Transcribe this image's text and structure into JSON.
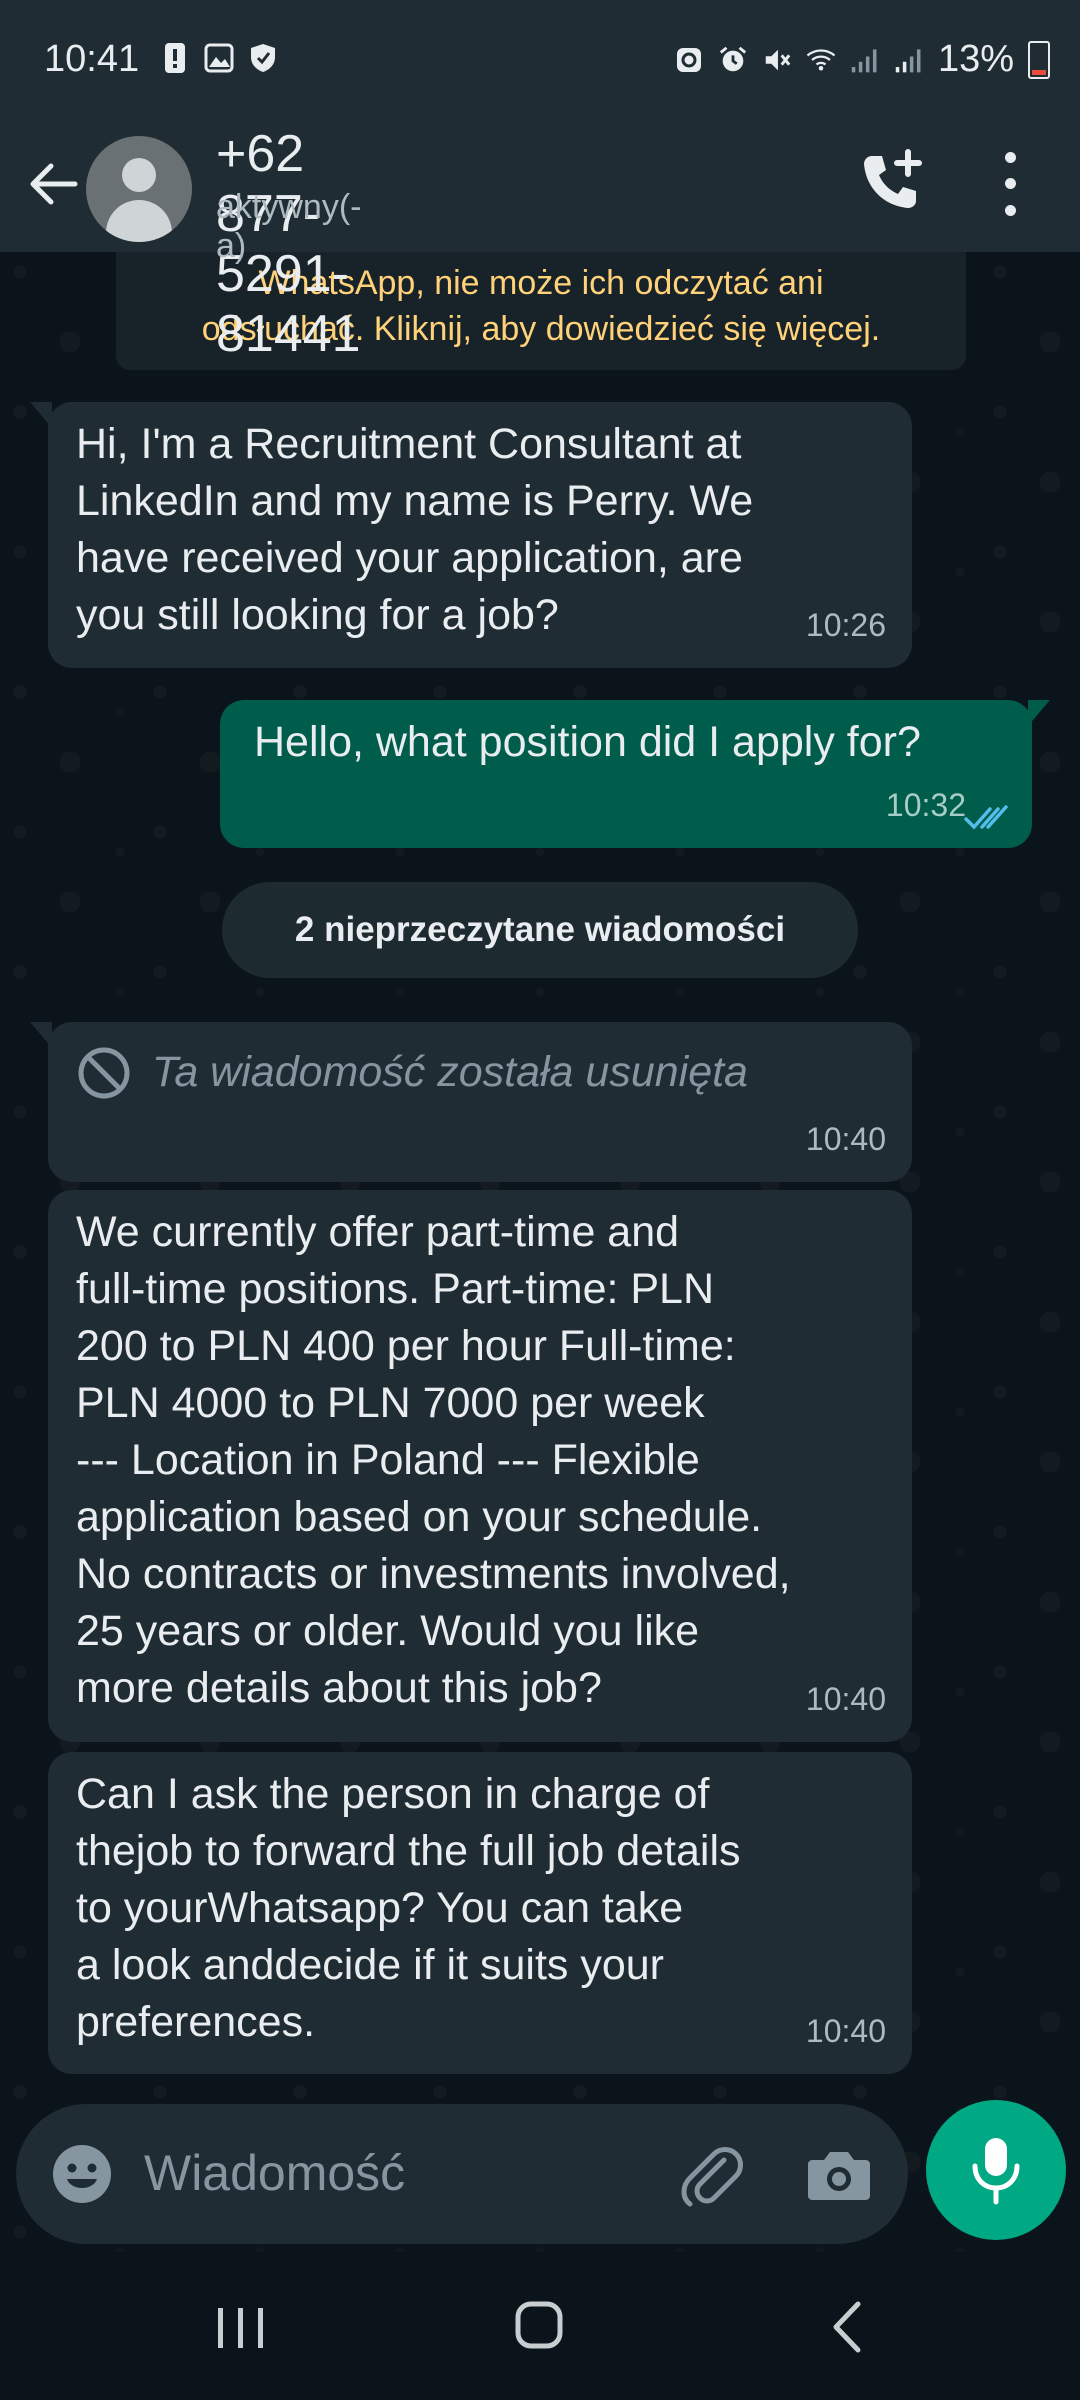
{
  "status_bar": {
    "time": "10:41",
    "battery": "13%"
  },
  "header": {
    "contact_name": "+62 877-5291-81441",
    "contact_status": "aktywny(-a)"
  },
  "encryption_notice": {
    "line1": "WhatsApp, nie może ich odczytać ani",
    "line2": "odsłuchać. Kliknij, aby dowiedzieć się więcej."
  },
  "messages": [
    {
      "direction": "incoming",
      "lines": [
        "Hi, I'm a Recruitment Consultant at",
        "LinkedIn and my name is Perry. We",
        "have received your application, are",
        "you still looking for a job?"
      ],
      "time": "10:26"
    },
    {
      "direction": "outgoing",
      "lines": [
        "Hello, what position did I apply for?"
      ],
      "time": "10:32",
      "status": "read"
    },
    {
      "direction": "incoming",
      "deleted": true,
      "lines": [
        "Ta wiadomość została usunięta"
      ],
      "time": "10:40"
    },
    {
      "direction": "incoming",
      "lines": [
        "We currently offer part-time and",
        "full-time positions. Part-time: PLN",
        "200 to PLN 400 per hour Full-time:",
        "PLN 4000 to PLN 7000 per week",
        "--- Location in Poland --- Flexible",
        "application based on your schedule.",
        "No contracts or investments involved,",
        "25 years or older. Would you like",
        "more details about this job?"
      ],
      "time": "10:40"
    },
    {
      "direction": "incoming",
      "lines": [
        "Can I ask the person in charge of",
        "thejob to forward the full job details",
        "to yourWhatsapp? You can take",
        "a look anddecide if it suits your",
        "preferences."
      ],
      "time": "10:40"
    }
  ],
  "unread_divider": "2 nieprzeczytane wiadomości",
  "composer": {
    "placeholder": "Wiadomość"
  },
  "colors": {
    "header_bg": "#1f2c33",
    "incoming_bubble": "#202c33",
    "outgoing_bubble": "#005c4b",
    "accent": "#00a884",
    "notice_text": "#ffd279",
    "read_ticks": "#53bdeb"
  },
  "icons": {
    "header": [
      "back-arrow-icon",
      "avatar",
      "add-call-icon",
      "more-vert-icon"
    ],
    "composer": [
      "emoji-icon",
      "attach-icon",
      "camera-icon",
      "mic-icon"
    ],
    "nav": [
      "recent-apps-icon",
      "home-icon",
      "back-icon"
    ]
  }
}
